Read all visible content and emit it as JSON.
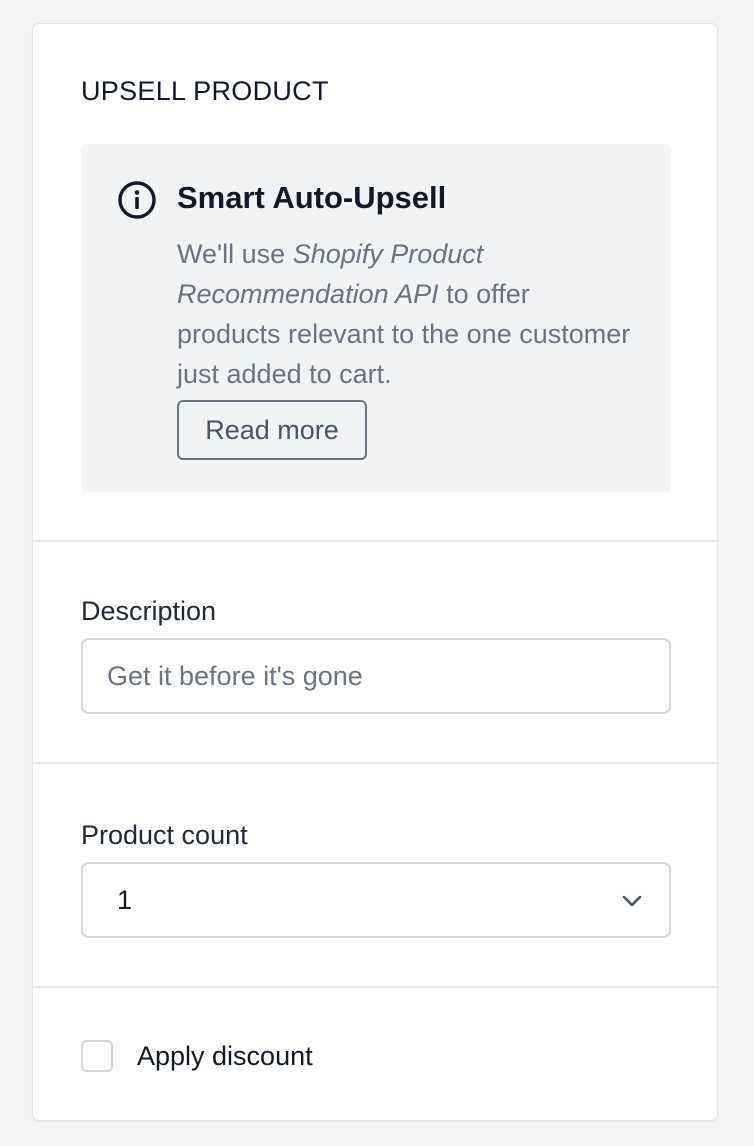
{
  "upsell": {
    "heading": "UPSELL PRODUCT",
    "info": {
      "icon": "info-icon",
      "title": "Smart Auto-Upsell",
      "text_before": "We'll use ",
      "text_emphasis": "Shopify Product Recommendation API",
      "text_after": " to offer products relevant to the one customer just added to cart.",
      "read_more_label": "Read more"
    }
  },
  "description": {
    "label": "Description",
    "placeholder": "Get it before it's gone",
    "value": ""
  },
  "product_count": {
    "label": "Product count",
    "selected": "1",
    "icon": "chevron-down-icon"
  },
  "discount": {
    "label": "Apply discount",
    "checked": false
  },
  "colors": {
    "page_bg": "#f4f4f5",
    "card_bg": "#ffffff",
    "info_bg": "#f2f3f5",
    "border": "#d1d5db",
    "muted_text": "#6b7280",
    "text": "#111827"
  }
}
